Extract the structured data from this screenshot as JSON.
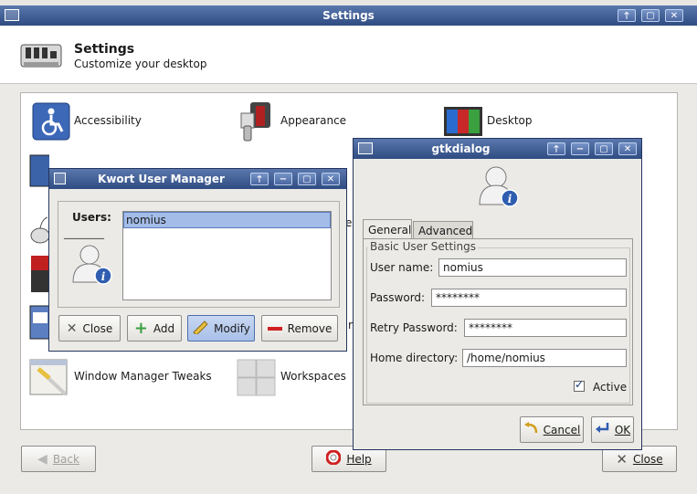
{
  "settings": {
    "title": "Settings",
    "header_title": "Settings",
    "header_subtitle": "Customize your desktop",
    "items": {
      "accessibility": "Accessibility",
      "appearance": "Appearance",
      "desktop": "Desktop",
      "wm_tweaks": "Window Manager Tweaks",
      "workspaces": "Workspaces",
      "partial_r": "r",
      "partial_e": "e"
    },
    "back_label": "Back",
    "help_label": "Help",
    "close_label": "Close"
  },
  "kwort": {
    "title": "Kwort User Manager",
    "users_label": "Users:",
    "users_underline": "________",
    "users": [
      "nomius"
    ],
    "close_label": "Close",
    "add_label": "Add",
    "modify_label": "Modify",
    "remove_label": "Remove"
  },
  "gtk": {
    "title": "gtkdialog",
    "tabs": [
      "General",
      "Advanced"
    ],
    "section_label": "Basic User Settings",
    "username_label": "User name:",
    "username_value": "nomius",
    "password_label": "Password:",
    "password_value": "********",
    "retry_label": "Retry Password:",
    "retry_value": "********",
    "home_label": "Home directory:",
    "home_value": "/home/nomius",
    "active_label": "Active",
    "active_checked": true,
    "cancel_label": "Cancel",
    "ok_label": "OK"
  },
  "icons": [
    "settings-icon",
    "accessibility-icon",
    "appearance-icon",
    "desktop-icon",
    "wm-tweaks-icon",
    "workspaces-icon",
    "user-icon",
    "back-icon",
    "help-icon",
    "close-icon",
    "add-icon",
    "modify-icon",
    "remove-icon",
    "cancel-icon",
    "ok-icon",
    "check-icon"
  ]
}
